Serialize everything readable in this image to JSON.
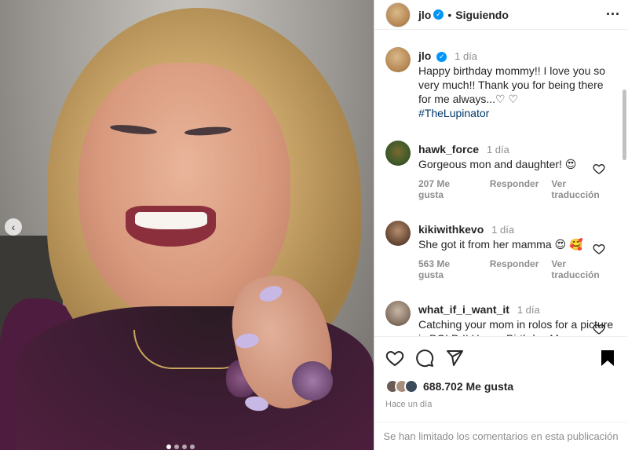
{
  "post": {
    "username": "jlo",
    "follow_state": "Siguiendo",
    "caption": {
      "time": "1 día",
      "text": "Happy birthday mommy!! I love you so very much!! Thank you for being there for me always...♡ ♡",
      "hashtag": "#TheLupinator"
    }
  },
  "comments": [
    {
      "username": "hawk_force",
      "time": "1 día",
      "text": "Gorgeous mon and daughter! 😍",
      "likes": "207 Me gusta",
      "reply": "Responder",
      "translate": "Ver traducción"
    },
    {
      "username": "kikiwithkevo",
      "time": "1 día",
      "text": "She got it from her mamma 😍 🥰",
      "likes": "563 Me gusta",
      "reply": "Responder",
      "translate": "Ver traducción"
    },
    {
      "username": "what_if_i_want_it",
      "time": "1 día",
      "text": "Catching your mom in rolos for a picture is BOLD !! Happy Birthday Ms Rodriguez. Que dios te bendiga siempre ❤️"
    }
  ],
  "footer": {
    "likes": "688.702 Me gusta",
    "posted": "Hace un día",
    "limited_notice": "Se han limitado los comentarios en esta publicación"
  },
  "carousel": {
    "slides": 4,
    "active": 1
  },
  "colors": {
    "verified": "#0095f6",
    "hashtag": "#00376b",
    "muted": "#8e8e8e"
  }
}
